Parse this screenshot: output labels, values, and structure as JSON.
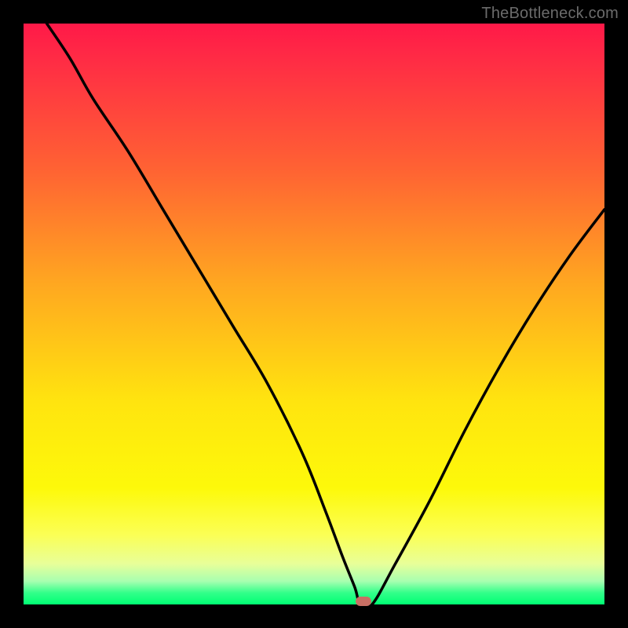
{
  "watermark": "TheBottleneck.com",
  "colors": {
    "curve": "#000000",
    "marker": "#c86f64",
    "gradient_top": "#ff1948",
    "gradient_mid1": "#ffa820",
    "gradient_mid2": "#ffe40f",
    "gradient_bottom": "#00ff73"
  },
  "chart_data": {
    "type": "line",
    "title": "",
    "xlabel": "",
    "ylabel": "",
    "xlim": [
      0,
      100
    ],
    "ylim": [
      0,
      100
    ],
    "grid": false,
    "legend": false,
    "series": [
      {
        "name": "bottleneck-curve",
        "x": [
          4,
          8,
          12,
          18,
          24,
          30,
          36,
          42,
          48,
          52,
          55,
          57,
          58,
          60,
          64,
          70,
          76,
          82,
          88,
          94,
          100
        ],
        "y": [
          100,
          94,
          87,
          78,
          68,
          58,
          48,
          38,
          26,
          16,
          8,
          3,
          0,
          0,
          7,
          18,
          30,
          41,
          51,
          60,
          68
        ]
      }
    ],
    "marker": {
      "x": 58.5,
      "y": 0.5,
      "shape": "pill",
      "color": "#c86f64"
    }
  }
}
